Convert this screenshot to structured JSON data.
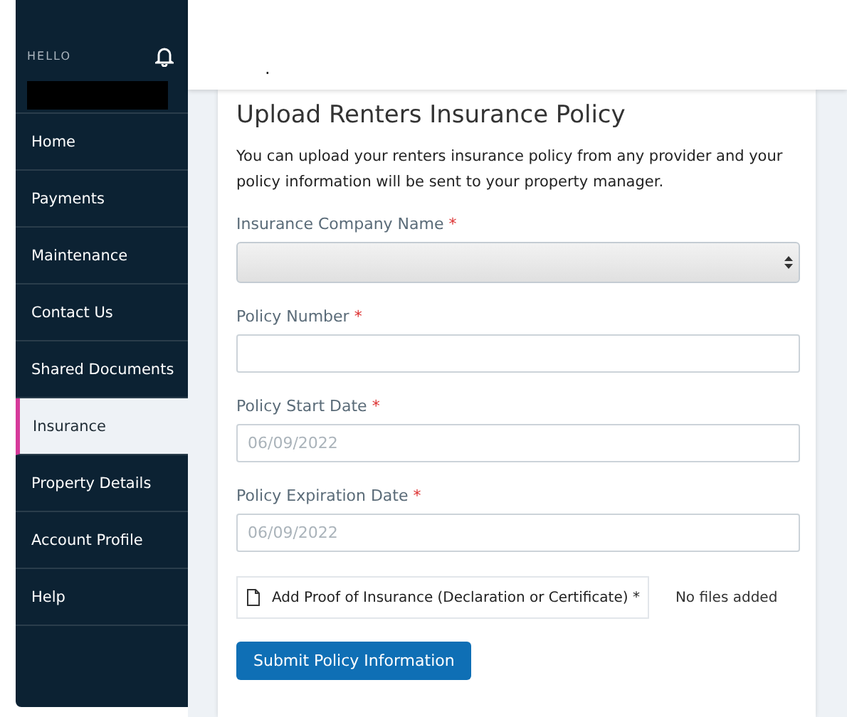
{
  "sidebar": {
    "greeting": "HELLO",
    "items": [
      {
        "label": "Home",
        "selected": false
      },
      {
        "label": "Payments",
        "selected": false
      },
      {
        "label": "Maintenance",
        "selected": false
      },
      {
        "label": "Contact Us",
        "selected": false
      },
      {
        "label": "Shared Documents",
        "selected": false
      },
      {
        "label": "Insurance",
        "selected": true
      },
      {
        "label": "Property Details",
        "selected": false
      },
      {
        "label": "Account Profile",
        "selected": false
      },
      {
        "label": "Help",
        "selected": false
      }
    ]
  },
  "header": {
    "mark": "."
  },
  "form": {
    "title": "Upload Renters Insurance Policy",
    "intro": "You can upload your renters insurance policy from any provider and your policy information will be sent to your property manager.",
    "fields": [
      {
        "kind": "select",
        "label": "Insurance Company Name",
        "required": "*"
      },
      {
        "kind": "text",
        "label": "Policy Number",
        "required": "*"
      },
      {
        "kind": "date",
        "label": "Policy Start Date",
        "required": "*",
        "placeholder": "06/09/2022"
      },
      {
        "kind": "date",
        "label": "Policy Expiration Date",
        "required": "*",
        "placeholder": "06/09/2022"
      }
    ],
    "upload": {
      "label": "Add Proof of Insurance (Declaration or Certificate) *",
      "status": "No files added"
    },
    "submit": "Submit Policy Information"
  }
}
